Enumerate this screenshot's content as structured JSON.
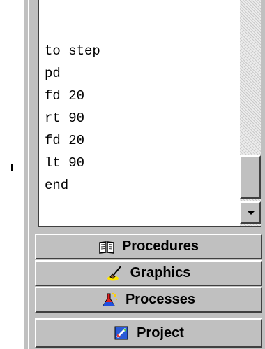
{
  "editor": {
    "lines": [
      "to step",
      "pd",
      "fd 20",
      "rt 90",
      "fd 20",
      "lt 90",
      "end"
    ]
  },
  "tabs": [
    {
      "label": "Procedures",
      "icon": "open-book-icon"
    },
    {
      "label": "Graphics",
      "icon": "paint-brush-icon"
    },
    {
      "label": "Processes",
      "icon": "flask-icon"
    },
    {
      "label": "Project",
      "icon": "project-file-icon"
    }
  ]
}
